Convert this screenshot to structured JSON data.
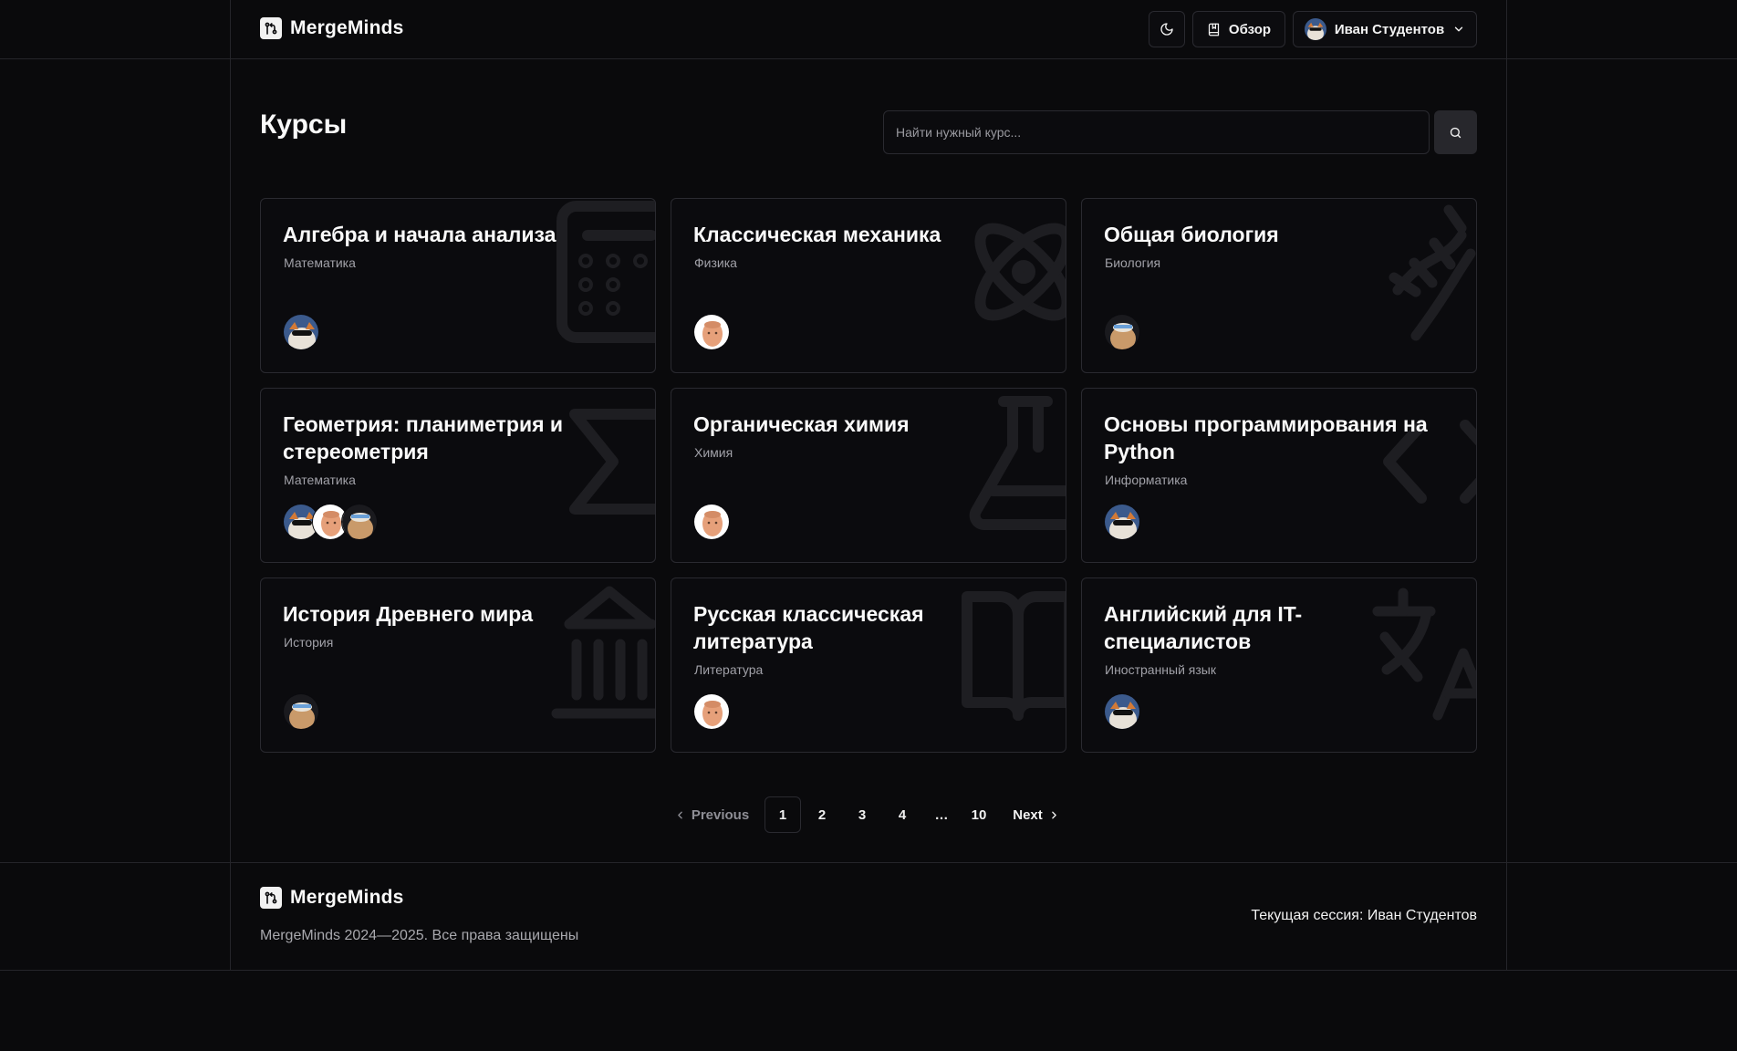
{
  "header": {
    "brand": "MergeMinds",
    "overview_label": "Обзор",
    "user_name": "Иван Студентов"
  },
  "page": {
    "title": "Курсы",
    "search_placeholder": "Найти нужный курс..."
  },
  "courses": [
    {
      "title": "Алгебра и начала анализа",
      "category": "Математика",
      "icon": "calculator-icon"
    },
    {
      "title": "Классическая механика",
      "category": "Физика",
      "icon": "atom-icon"
    },
    {
      "title": "Общая биология",
      "category": "Биология",
      "icon": "dna-icon"
    },
    {
      "title": "Геометрия: планиметрия и стереометрия",
      "category": "Математика",
      "icon": "sigma-icon"
    },
    {
      "title": "Органическая химия",
      "category": "Химия",
      "icon": "flask-icon"
    },
    {
      "title": "Основы программирования на Python",
      "category": "Информатика",
      "icon": "code-icon"
    },
    {
      "title": "История Древнего мира",
      "category": "История",
      "icon": "landmark-icon"
    },
    {
      "title": "Русская классическая литература",
      "category": "Литература",
      "icon": "book-icon"
    },
    {
      "title": "Английский для IT-специалистов",
      "category": "Иностранный язык",
      "icon": "languages-icon"
    }
  ],
  "pagination": {
    "previous": "Previous",
    "next": "Next",
    "pages": [
      "1",
      "2",
      "3",
      "4",
      "…",
      "10"
    ],
    "current": "1"
  },
  "footer": {
    "brand": "MergeMinds",
    "copyright": "MergeMinds 2024—2025. Все права защищены",
    "session": "Текущая сессия: Иван Студентов"
  },
  "colors": {
    "background": "#0a0a0c",
    "border": "#2a2a30",
    "muted_text": "#a1a1a8"
  }
}
